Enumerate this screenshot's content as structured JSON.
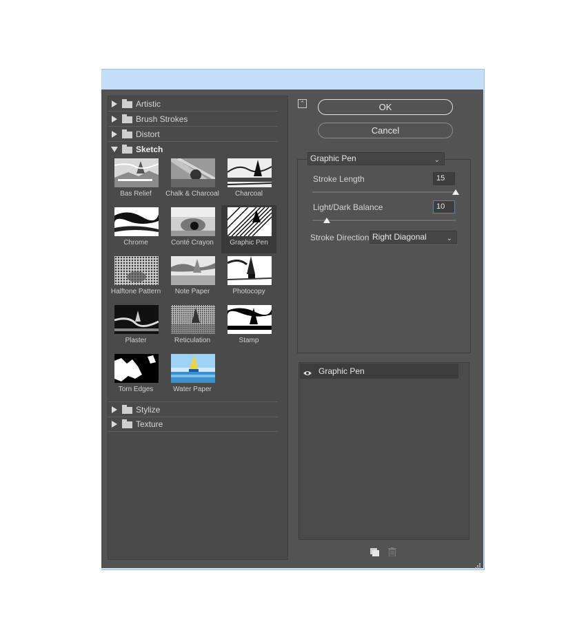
{
  "categories_top": [
    {
      "label": "Artistic",
      "open": false
    },
    {
      "label": "Brush Strokes",
      "open": false
    },
    {
      "label": "Distort",
      "open": false
    },
    {
      "label": "Sketch",
      "open": true
    }
  ],
  "categories_bottom": [
    {
      "label": "Stylize",
      "open": false
    },
    {
      "label": "Texture",
      "open": false
    }
  ],
  "thumbnails": [
    {
      "label": "Bas Relief",
      "icon": "bas-relief-thumbnail"
    },
    {
      "label": "Chalk & Charcoal",
      "icon": "chalk-charcoal-thumbnail"
    },
    {
      "label": "Charcoal",
      "icon": "charcoal-thumbnail"
    },
    {
      "label": "Chrome",
      "icon": "chrome-thumbnail"
    },
    {
      "label": "Conté Crayon",
      "icon": "conte-crayon-thumbnail"
    },
    {
      "label": "Graphic Pen",
      "icon": "graphic-pen-thumbnail",
      "selected": true
    },
    {
      "label": "Halftone Pattern",
      "icon": "halftone-pattern-thumbnail"
    },
    {
      "label": "Note Paper",
      "icon": "note-paper-thumbnail"
    },
    {
      "label": "Photocopy",
      "icon": "photocopy-thumbnail"
    },
    {
      "label": "Plaster",
      "icon": "plaster-thumbnail"
    },
    {
      "label": "Reticulation",
      "icon": "reticulation-thumbnail"
    },
    {
      "label": "Stamp",
      "icon": "stamp-thumbnail"
    },
    {
      "label": "Torn Edges",
      "icon": "torn-edges-thumbnail"
    },
    {
      "label": "Water Paper",
      "icon": "water-paper-thumbnail"
    }
  ],
  "buttons": {
    "ok": "OK",
    "cancel": "Cancel"
  },
  "filter_select": "Graphic Pen",
  "params": {
    "stroke_length": {
      "label": "Stroke Length",
      "value": "15",
      "fraction": 1.0
    },
    "light_dark_balance": {
      "label": "Light/Dark Balance",
      "value": "10",
      "fraction": 0.1
    },
    "stroke_direction": {
      "label": "Stroke Direction:",
      "value": "Right Diagonal"
    }
  },
  "effect_layer": {
    "name": "Graphic Pen",
    "icon": "eye-icon"
  },
  "colors": {
    "dialog_bg": "#535353",
    "panel_bg": "#4a4a4a",
    "accent_focus": "#4f86c6",
    "titlebar": "#c4defa"
  }
}
